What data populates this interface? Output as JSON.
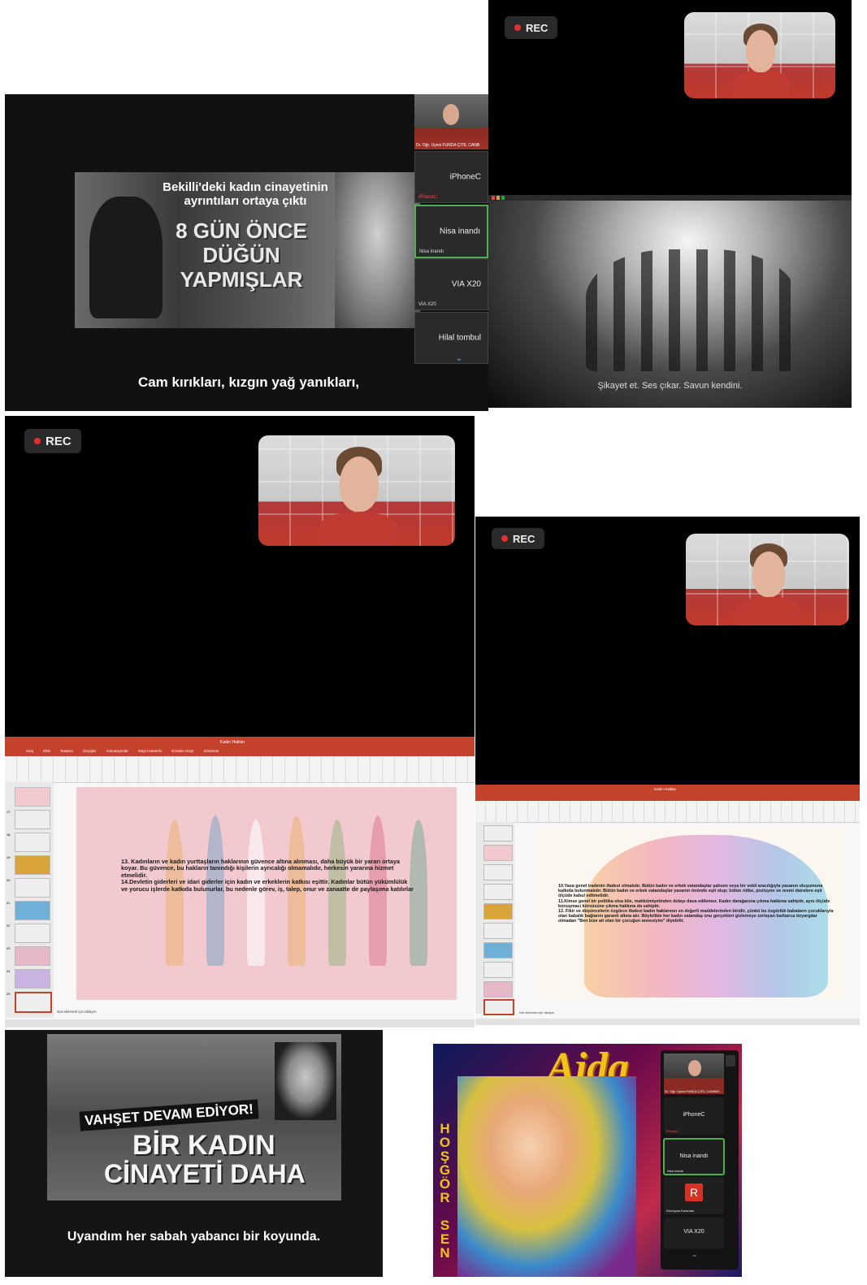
{
  "panel1": {
    "headline": "Bekilli'deki kadın cinayetinin ayrıntıları ortaya çıktı",
    "big_text": "8 GÜN ÖNCE DÜĞÜN YAPMIŞLAR",
    "subtitle": "Cam kırıkları, kızgın yağ yanıkları,",
    "presenter_label": "Dr. Öğr. Üyesi FUNDA ÇİTİL CANB",
    "participants": [
      {
        "name": "iPhoneC",
        "small": "iPhoneC"
      },
      {
        "name": "Nisa inandı",
        "small": "Nisa inandı"
      },
      {
        "name": "VIA X20",
        "small": "VIA X20"
      },
      {
        "name": "Hilal tombul",
        "small": ""
      }
    ]
  },
  "panel2": {
    "rec_label": "REC",
    "subtitle": "Şikayet et. Ses çıkar. Savun kendini."
  },
  "panel3": {
    "rec_label": "REC",
    "ppt_title": "Kadın Hakları",
    "notes": "Not eklemek için tıklayın",
    "slide_text": "13. Kadınların ve kadın yurttaşların haklarının güvence altına alınması, daha büyük bir yararı ortaya koyar. Bu güvence, bu hakların tanındığı kişilerin ayrıcalığı olmamalıdır, herkesin yararına hizmet etmelidir.\n14.Devletin giderleri ve idari giderler için kadın ve erkeklerin katkısı eşittir. Kadınlar bütün yükümlülük ve yorucu işlerde katkıda bulunurlar, bu nedenle görev, iş, talep, onur ve zanaatte de paylaşıma katılırlar",
    "menu": [
      "Giriş",
      "Ekle",
      "Tasarım",
      "Geçişler",
      "Animasyonlar",
      "Slayt Gösterisi",
      "Gözden Geçir",
      "Görünüm"
    ],
    "thumb_numbers": [
      "17",
      "18",
      "19",
      "20",
      "21",
      "22",
      "23",
      "24",
      "25"
    ]
  },
  "panel4": {
    "rec_label": "REC",
    "ppt_title": "Kadın Hakları",
    "notes": "Not eklemek için tıklayın",
    "slide_text": "10.Yasa genel iradenin ifadesi olmalıdır. Bütün kadın ve erkek vatandaşlar şahsen veya bir vekil aracılığıyla yasanın oluşumuna katkıda bulunmalıdır. Bütün kadın ve erkek vatandaşlar yasanın önünde eşit olup; bütün rütbe, pozisyon ve resmi dairelere eşit ölçüde kabul edilmelidir.\n11.Kimse genel bir politika olsa bile, mahkûmiyetinden dolayı dava edilemez. Kadın darağacına çıkma hakkına sahiptir, aynı ölçüde konuşmacı kürsüsüne çıkma hakkına da sahiptir.\n12. Fikir ve düşüncelerin özgürce ifadesi kadın haklarının en değerli maddelerinden biridir, çünkü bu özgürlük babaların çocuklarıyla olan babalık bağlarını garanti altına alır. Böylelikle her kadın vatandaş onu gerçekleri gizlemeye zorlayan barbarca önyargılar olmadan \"Ben bize ait olan bir çocuğun annesiyim\" diyebilir."
  },
  "panel5": {
    "line1": "VAHŞET DEVAM EDİYOR!",
    "line2": "BİR KADIN",
    "line3": "CİNAYETİ DAHA",
    "subtitle": "Uyandım her sabah yabancı bir koyunda."
  },
  "panel6": {
    "album_title": "Ajda",
    "vertical_text": "HOŞGÖR SEN",
    "presenter_label": "Dr. Öğr. Üyesi FUNDA ÇİTİL CANBEK",
    "participants": [
      "iPhoneC",
      "Nisa inandı",
      "R",
      "VIA X20"
    ],
    "small_labels": [
      "iPhoneC",
      "Nisa inandı",
      "Rumeysa Karaman"
    ]
  },
  "colors": {
    "rec_dot": "#e23030",
    "ppt_accent": "#c4412b",
    "zoom_active_border": "#4caf50",
    "slide3_bg": "#f2c9cf",
    "avatar_r": "#d93025"
  }
}
